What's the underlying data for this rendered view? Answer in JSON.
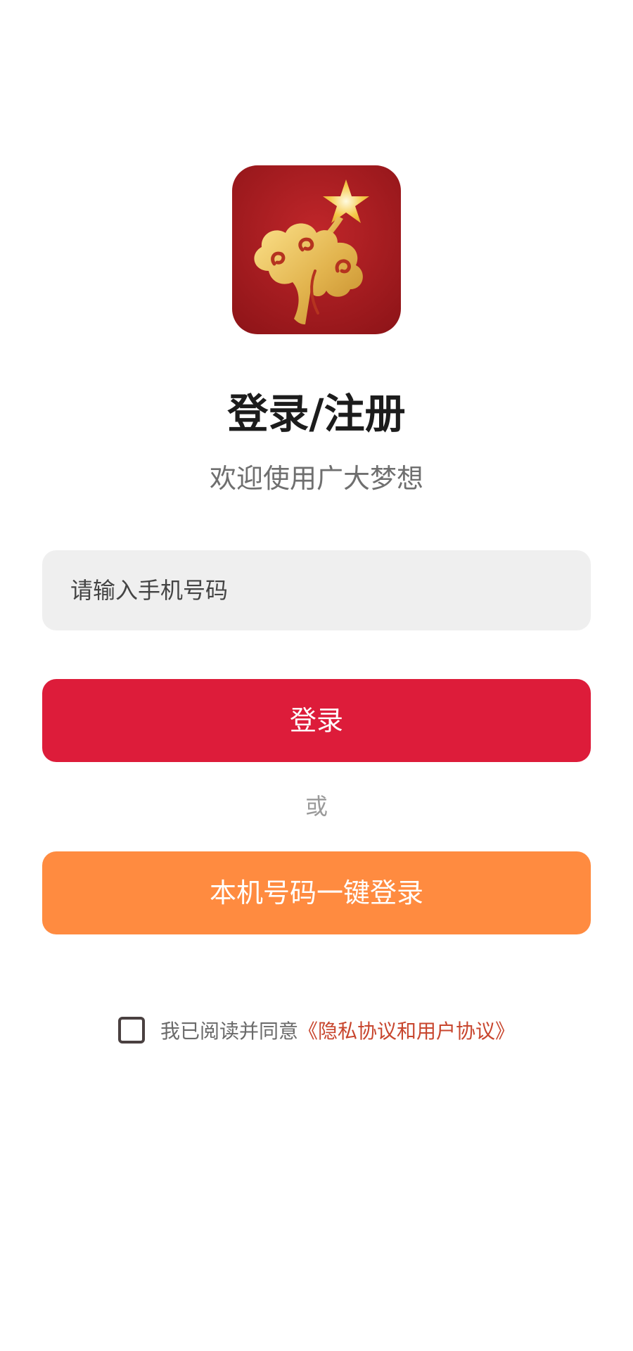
{
  "app": {
    "logo_icon": "red-star-cloud-logo-icon"
  },
  "header": {
    "title": "登录/注册",
    "subtitle": "欢迎使用广大梦想"
  },
  "form": {
    "phone_placeholder": "请输入手机号码",
    "phone_value": "",
    "login_label": "登录",
    "or_label": "或",
    "quick_login_label": "本机号码一键登录"
  },
  "agreement": {
    "checked": false,
    "text": "我已阅读并同意",
    "link_text": "《隐私协议和用户协议》"
  },
  "colors": {
    "primary_red": "#dd1c3a",
    "secondary_orange": "#ff8b40",
    "link_color": "#c8462e",
    "input_bg": "#efefef"
  }
}
